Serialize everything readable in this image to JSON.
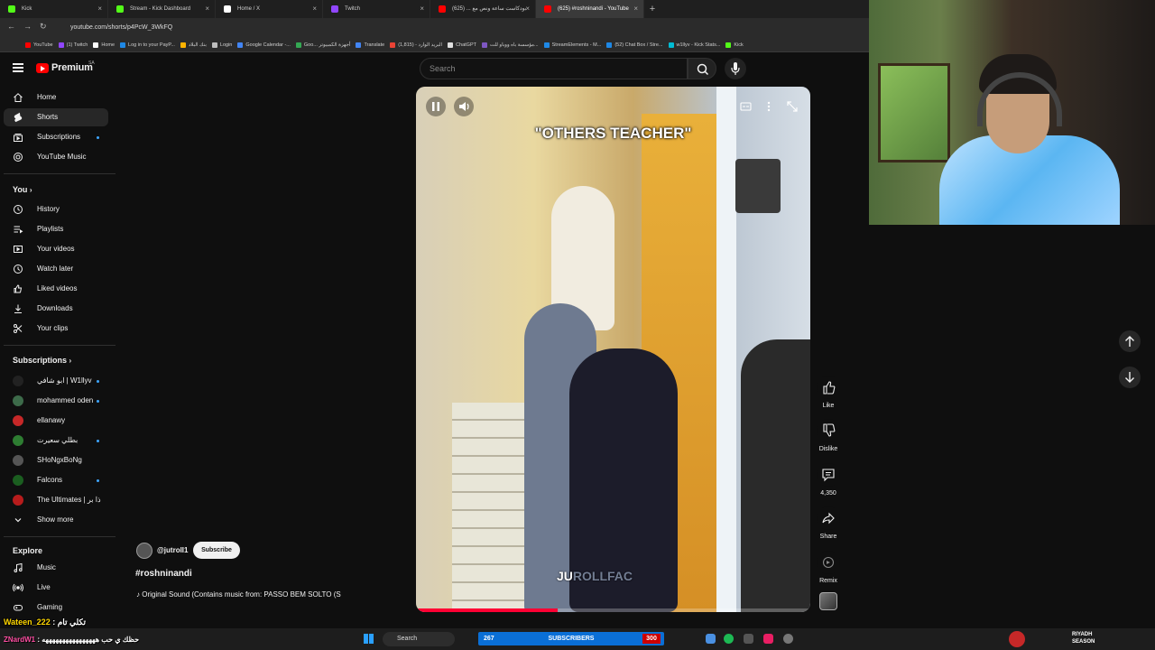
{
  "browser": {
    "tabs": [
      {
        "label": "Kick",
        "color": "#53fc18"
      },
      {
        "label": "Stream - Kick Dashboard",
        "color": "#53fc18"
      },
      {
        "label": "Home / X",
        "color": "#ffffff"
      },
      {
        "label": "Twitch",
        "color": "#9146ff"
      },
      {
        "label": "بودكاست ساعة ونص مع ... (625)",
        "color": "#ff0000"
      },
      {
        "label": "(625) #roshninandi - YouTube",
        "color": "#ff0000"
      }
    ],
    "new_tab": "+",
    "url": "youtube.com/shorts/p4PcW_3WkFQ",
    "bookmarks": [
      {
        "label": "YouTube",
        "color": "#ff0000"
      },
      {
        "label": "(1) Twitch",
        "color": "#9146ff"
      },
      {
        "label": "Home",
        "color": "#ffffff"
      },
      {
        "label": "Log in to your PayP...",
        "color": "#1e88e5"
      },
      {
        "label": "بنك البلاد",
        "color": "#ffb300"
      },
      {
        "label": "Login",
        "color": "#bdbdbd"
      },
      {
        "label": "Google Calendar -...",
        "color": "#4285f4"
      },
      {
        "label": "Goo... أجهزة الكمبيوتر",
        "color": "#34a853"
      },
      {
        "label": "Translate",
        "color": "#4285f4"
      },
      {
        "label": "البريد الوارد - (1,815)",
        "color": "#ea4335"
      },
      {
        "label": "ChatGPT",
        "color": "#e0e0e0"
      },
      {
        "label": "مؤسسة باه ووباو للت...",
        "color": "#7e57c2"
      },
      {
        "label": "StreamElements - M...",
        "color": "#1e88e5"
      },
      {
        "label": "(52) Chat Box / Stre...",
        "color": "#1e88e5"
      },
      {
        "label": "w1llyv - Kick Stats...",
        "color": "#00bcd4"
      },
      {
        "label": "Kick",
        "color": "#53fc18"
      }
    ]
  },
  "header": {
    "brand": "Premium",
    "region": "SA",
    "search_placeholder": "Search"
  },
  "sidebar": {
    "main": [
      {
        "label": "Home",
        "icon": "home-icon"
      },
      {
        "label": "Shorts",
        "icon": "shorts-icon",
        "active": true
      },
      {
        "label": "Subscriptions",
        "icon": "subscriptions-icon",
        "dot": true
      },
      {
        "label": "YouTube Music",
        "icon": "youtube-music-icon"
      }
    ],
    "you_title": "You",
    "you": [
      {
        "label": "History",
        "icon": "history-icon"
      },
      {
        "label": "Playlists",
        "icon": "playlists-icon"
      },
      {
        "label": "Your videos",
        "icon": "your-videos-icon"
      },
      {
        "label": "Watch later",
        "icon": "watch-later-icon"
      },
      {
        "label": "Liked videos",
        "icon": "liked-videos-icon"
      },
      {
        "label": "Downloads",
        "icon": "downloads-icon"
      },
      {
        "label": "Your clips",
        "icon": "clips-icon"
      }
    ],
    "subscriptions_title": "Subscriptions",
    "subscriptions": [
      {
        "label": "ابو شافي | W1llyv",
        "color": "#222222",
        "dot": true
      },
      {
        "label": "mohammed oden",
        "color": "#3d6b4a",
        "dot": true
      },
      {
        "label": "ellanawy",
        "color": "#c62828",
        "dot": false
      },
      {
        "label": "بطلي سعيرت",
        "color": "#2e7d32",
        "dot": true
      },
      {
        "label": "SHoNgxBoNg",
        "color": "#555555",
        "dot": false
      },
      {
        "label": "Falcons",
        "color": "#1b5e20",
        "dot": true
      },
      {
        "label": "The Ultimates | ذا بر",
        "color": "#b71c1c",
        "dot": false
      }
    ],
    "show_more": "Show more",
    "explore_title": "Explore",
    "explore": [
      {
        "label": "Music",
        "icon": "music-icon"
      },
      {
        "label": "Live",
        "icon": "live-icon"
      },
      {
        "label": "Gaming",
        "icon": "gaming-icon"
      }
    ]
  },
  "video": {
    "overlay_text": "\"OTHERS TEACHER\"",
    "watermark_a": "JU",
    "watermark_b": "ROLLFAC",
    "progress": 0.36
  },
  "actions": {
    "like": "Like",
    "dislike": "Dislike",
    "comments": "4,350",
    "share": "Share",
    "remix": "Remix"
  },
  "channel": {
    "handle": "@jutroll1",
    "subscribe": "Subscribe",
    "hashtag": "#roshninandi",
    "sound": "♪ Original Sound (Contains music from: PASSO BEM SOLTO (S"
  },
  "stream_overlay": {
    "chat1_name": "Wateen_222",
    "chat1_msg": ": تكلي تام",
    "chat2_name": "ZNardW1",
    "chat2_msg": ": حظك ي حب ههههههههههههههههه",
    "taskbar_search": "Search",
    "sub_count": "267",
    "sub_title": "SUBSCRIBERS",
    "sub_goal": "300",
    "riyadh_line1": "RIYADH",
    "riyadh_line2": "SEASON"
  }
}
